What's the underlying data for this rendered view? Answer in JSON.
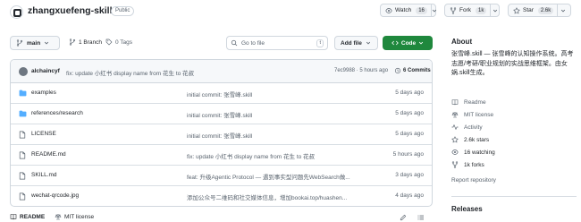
{
  "repo": {
    "name": "zhangxuefeng-skill",
    "visibility": "Public"
  },
  "header_actions": {
    "watch": {
      "label": "Watch",
      "count": "16"
    },
    "fork": {
      "label": "Fork",
      "count": "1k"
    },
    "star": {
      "label": "Star",
      "count": "2.6k"
    }
  },
  "toolbar": {
    "branch": "main",
    "branches": "1 Branch",
    "tags": "0 Tags",
    "goto_placeholder": "Go to file",
    "goto_key": "t",
    "add_file": "Add file",
    "code": "Code"
  },
  "latest_commit": {
    "author": "alchaincyf",
    "message": "fix: update 小红书 display name from 花生 to 花叔",
    "hash_time": "7ec9988 · 5 hours ago",
    "commits": "6 Commits"
  },
  "files": [
    {
      "name": "examples",
      "type": "folder",
      "message": "initial commit: 张雪峰.skill",
      "age": "5 days ago"
    },
    {
      "name": "references/research",
      "type": "folder",
      "message": "initial commit: 张雪峰.skill",
      "age": "5 days ago"
    },
    {
      "name": "LICENSE",
      "type": "file",
      "message": "initial commit: 张雪峰.skill",
      "age": "5 days ago"
    },
    {
      "name": "README.md",
      "type": "file",
      "message": "fix: update 小红书 display name from 花生 to 花叔",
      "age": "5 hours ago"
    },
    {
      "name": "SKILL.md",
      "type": "file",
      "message": "feat: 升级Agentic Protocol — 遇到事实型问题先WebSearch做...",
      "age": "3 days ago"
    },
    {
      "name": "wechat-qrcode.jpg",
      "type": "file",
      "message": "添加公众号二维码和社交媒体信息，增加bookai.top/huashen...",
      "age": "4 days ago"
    }
  ],
  "readme_tabs": {
    "readme": "README",
    "license": "MIT license"
  },
  "about": {
    "heading": "About",
    "description": "张雪峰.skill — 张雪峰的认知操作系统。高考志愿/考研/职业规划的实战思维框架。由女娲.skill生成。",
    "readme": "Readme",
    "license": "MIT license",
    "activity": "Activity",
    "stars": "2.6k stars",
    "watching": "16 watching",
    "forks": "1k forks",
    "report": "Report repository"
  },
  "releases": {
    "heading": "Releases"
  },
  "colors": {
    "accent_green": "#1f883d",
    "folder_blue": "#54aeff",
    "muted": "#59636e"
  }
}
